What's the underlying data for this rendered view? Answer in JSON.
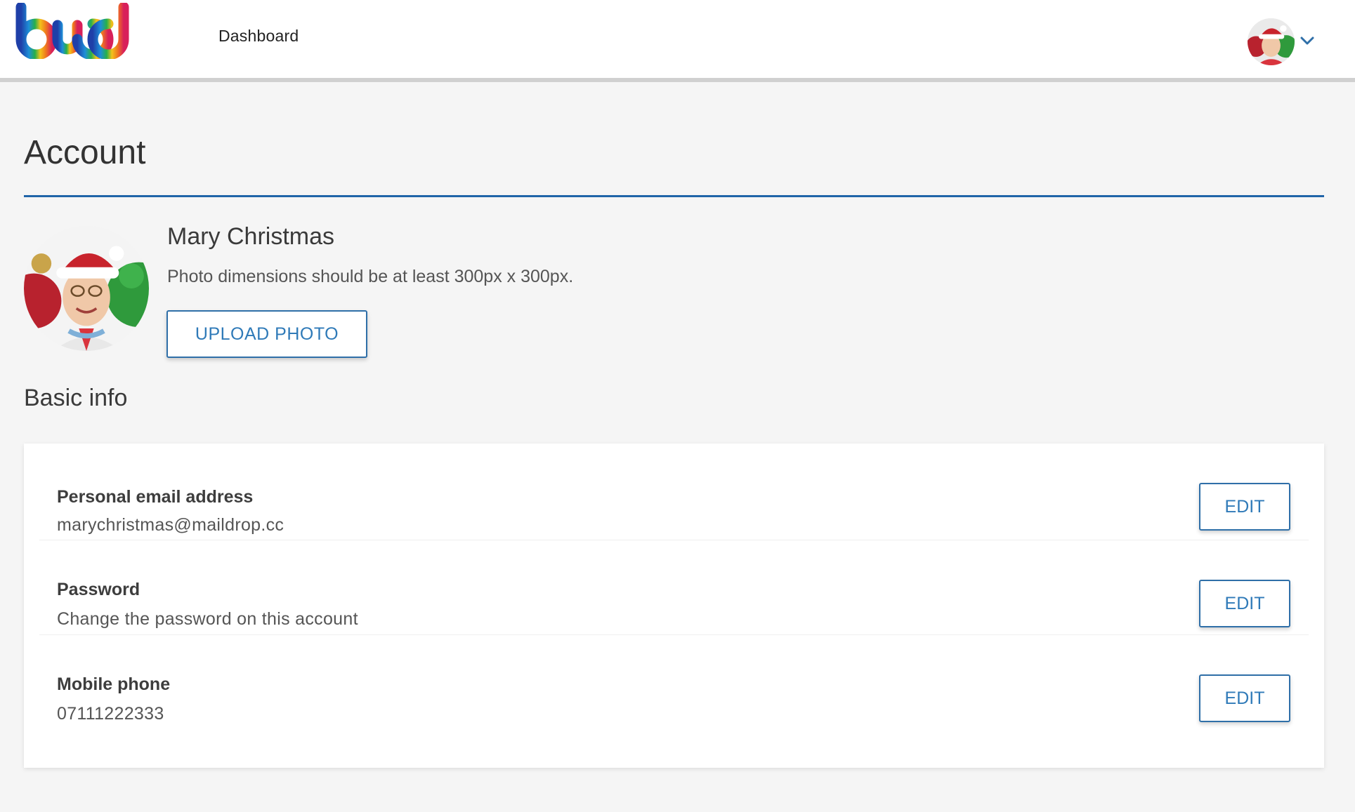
{
  "header": {
    "logo_text": "bud",
    "nav": {
      "dashboard": "Dashboard"
    }
  },
  "page": {
    "title": "Account"
  },
  "profile": {
    "name": "Mary Christmas",
    "photo_hint": "Photo dimensions should be at least 300px x 300px.",
    "upload_label": "UPLOAD PHOTO"
  },
  "basic_info": {
    "title": "Basic info",
    "rows": [
      {
        "label": "Personal email address",
        "value": "marychristmas@maildrop.cc",
        "action": "EDIT"
      },
      {
        "label": "Password",
        "value": "Change the password on this account",
        "action": "EDIT"
      },
      {
        "label": "Mobile phone",
        "value": "07111222333",
        "action": "EDIT"
      }
    ]
  },
  "icons": {
    "user_menu_chevron": "chevron-down-icon",
    "avatar": "user-avatar"
  },
  "colors": {
    "accent": "#2064a8",
    "button_text": "#2f7ab8",
    "background": "#f5f5f5"
  }
}
